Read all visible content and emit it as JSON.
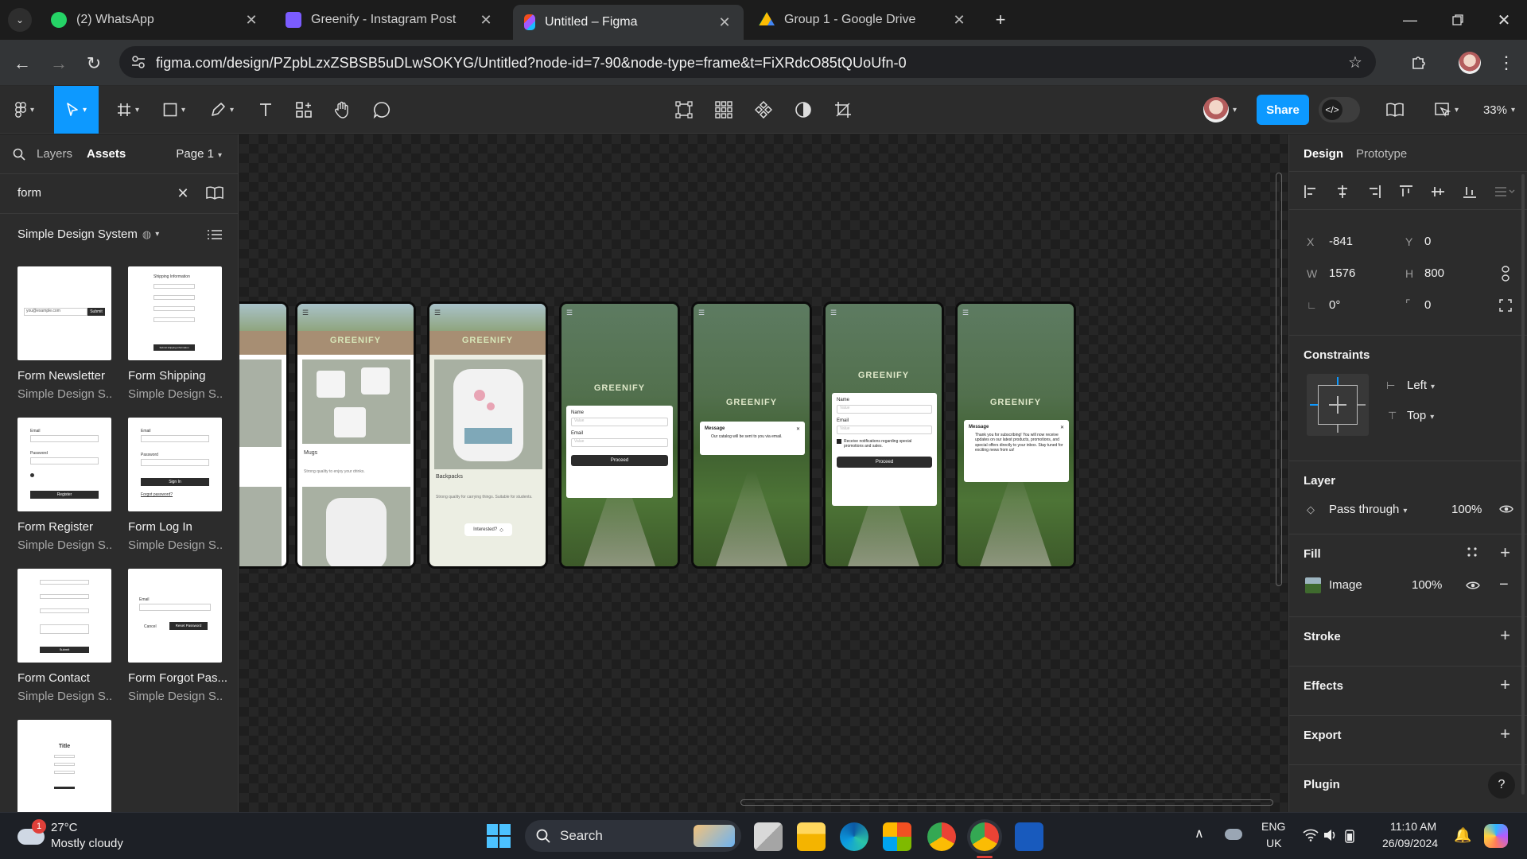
{
  "browser": {
    "tabs": [
      {
        "label": "(2) WhatsApp",
        "icon": "whatsapp-icon",
        "color": "#25d366"
      },
      {
        "label": "Greenify - Instagram Post",
        "icon": "canva-heart-icon",
        "color": "#7b5cff"
      },
      {
        "label": "Untitled – Figma",
        "icon": "figma-icon",
        "color": "#f24e1e",
        "active": true
      },
      {
        "label": "Group 1 - Google Drive",
        "icon": "google-drive-icon",
        "color": "#fbbc04"
      }
    ],
    "url": "figma.com/design/PZpbLzxZSBSB5uDLwSOKYG/Untitled?node-id=7-90&node-type=frame&t=FiXRdcO85tQUoUfn-0"
  },
  "toolbar": {
    "share_label": "Share",
    "zoom": "33%"
  },
  "left_panel": {
    "tab_layers": "Layers",
    "tab_assets": "Assets",
    "page": "Page 1",
    "search_value": "form",
    "library": "Simple Design System",
    "assets": [
      {
        "name": "Form Newsletter",
        "lib": "Simple Design S...",
        "email": "you@example.com",
        "btn": "Submit"
      },
      {
        "name": "Form Shipping",
        "lib": "Simple Design S...",
        "hdr": "Shipping Information",
        "btn": "Submit shipping information"
      },
      {
        "name": "Form Register",
        "lib": "Simple Design S...",
        "f1": "Email",
        "f2": "Password",
        "btn": "Register"
      },
      {
        "name": "Form Log In",
        "lib": "Simple Design S...",
        "f1": "Email",
        "f2": "Password",
        "btn": "Sign In",
        "link": "Forgot password?"
      },
      {
        "name": "Form Contact",
        "lib": "Simple Design S...",
        "btn": "Submit"
      },
      {
        "name": "Form Forgot Pas...",
        "lib": "Simple Design S...",
        "f1": "Email",
        "cancel": "Cancel",
        "btn": "Reset Password"
      },
      {
        "name": "",
        "lib": "",
        "hdr": "Title"
      }
    ]
  },
  "canvas": {
    "logo": "GREENIFY",
    "f2": {
      "caption": "Mugs",
      "desc": "Strong quality to enjoy your drinks."
    },
    "f3": {
      "caption": "Backpacks",
      "desc": "Strong quality for carrying things. Suitable for students.",
      "btn": "Interested?"
    },
    "f4": {
      "name": "Name",
      "email": "Email",
      "ph": "Value",
      "btn": "Proceed"
    },
    "f5": {
      "title": "Message",
      "body": "Our catalog will be sent to you via email."
    },
    "f6": {
      "name": "Name",
      "email": "Email",
      "ph": "Value",
      "check": "Receive notifications regarding special promotions and sales.",
      "btn": "Proceed"
    },
    "f7": {
      "title": "Message",
      "body": "Thank you for subscribing! You will now receive updates on our latest products, promotions, and special offers directly to your inbox. Stay tuned for exciting news from us!"
    }
  },
  "right_panel": {
    "tab_design": "Design",
    "tab_prototype": "Prototype",
    "x_label": "X",
    "x": "-841",
    "y_label": "Y",
    "y": "0",
    "w_label": "W",
    "w": "1576",
    "h_label": "H",
    "h": "800",
    "rotation": "0°",
    "radius": "0",
    "constraints_title": "Constraints",
    "constraint_h": "Left",
    "constraint_v": "Top",
    "layer_title": "Layer",
    "blend": "Pass through",
    "layer_opacity": "100%",
    "fill_title": "Fill",
    "fill_type": "Image",
    "fill_opacity": "100%",
    "stroke_title": "Stroke",
    "effects_title": "Effects",
    "export_title": "Export",
    "plugin_title": "Plugin",
    "help": "?"
  },
  "taskbar": {
    "weather_temp": "27°C",
    "weather_desc": "Mostly cloudy",
    "weather_badge": "1",
    "search": "Search",
    "lang1": "ENG",
    "lang2": "UK",
    "time": "11:10 AM",
    "date": "26/09/2024"
  }
}
